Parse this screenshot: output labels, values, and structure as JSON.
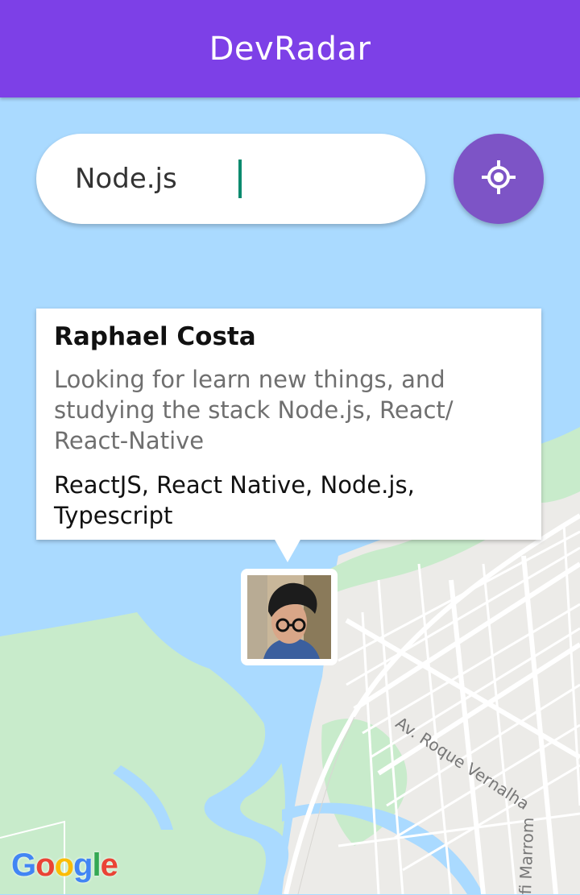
{
  "app": {
    "title": "DevRadar",
    "accent_color": "#7d40e7"
  },
  "search": {
    "value": "Node.js",
    "placeholder": ""
  },
  "locate_button": {
    "icon": "crosshair-icon"
  },
  "callout": {
    "name": "Raphael Costa",
    "bio": "Looking for learn new things, and studying the stack Node.js, React/ React-Native",
    "techs": "ReactJS, React Native, Node.js, Typescript"
  },
  "marker": {
    "icon": "avatar-photo"
  },
  "map": {
    "streets": [
      "Av. Roque Vernalha",
      "fi Marrom"
    ],
    "attribution": "Google",
    "colors": {
      "water": "#aadaff",
      "land": "#ecebe8",
      "park": "#c8ebcb",
      "road": "#ffffff"
    }
  }
}
